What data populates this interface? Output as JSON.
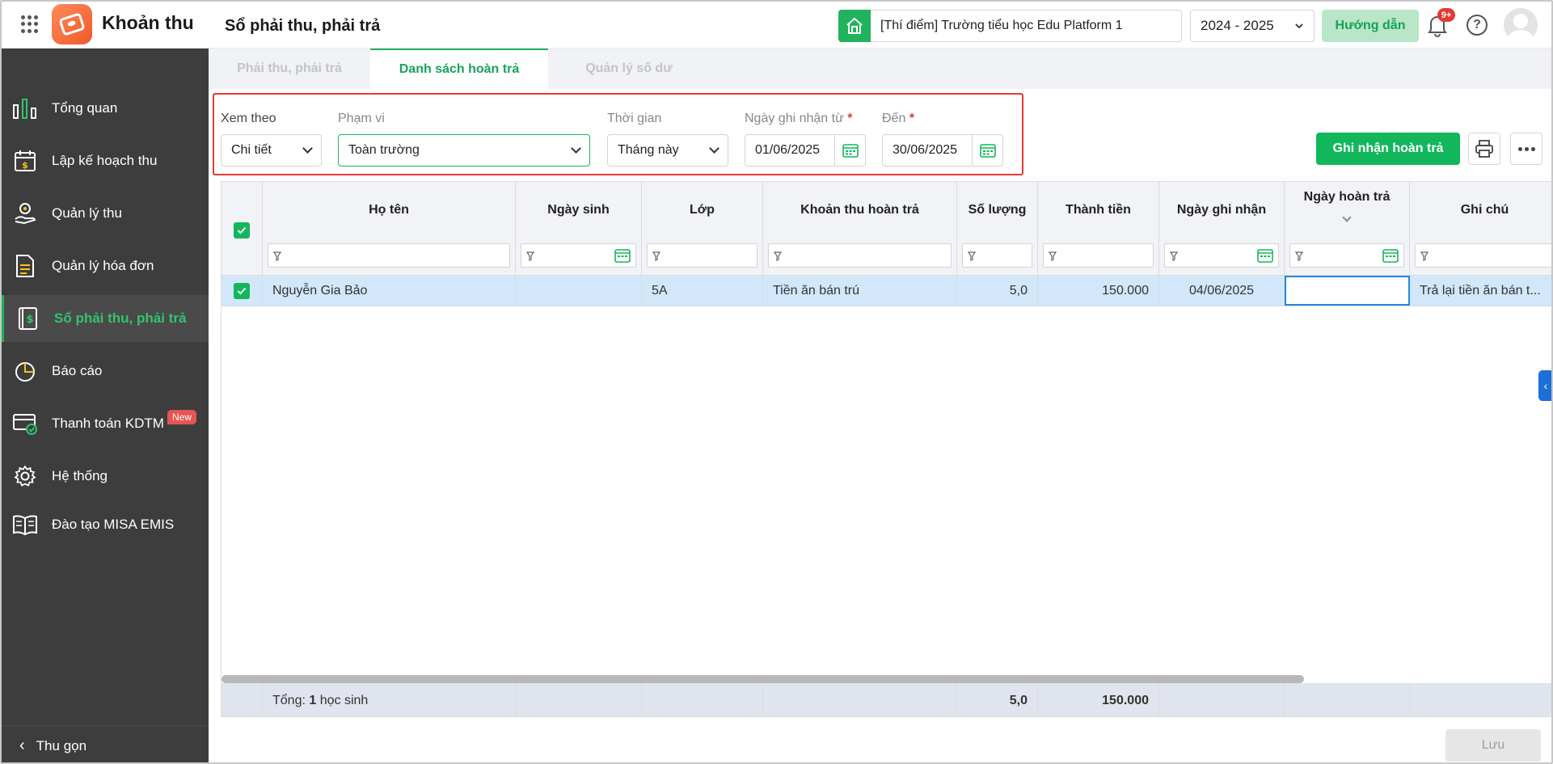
{
  "header": {
    "app_title": "Khoản thu",
    "page_title": "Sổ phải thu, phải trả",
    "school": "[Thí điểm] Trường tiểu học Edu Platform 1",
    "school_year": "2024 - 2025",
    "guide_label": "Hướng dẫn",
    "notification_badge": "9+",
    "help_glyph": "?"
  },
  "sidebar": {
    "items": [
      {
        "label": "Tổng quan",
        "icon": "bar-chart-icon"
      },
      {
        "label": "Lập kế hoạch thu",
        "icon": "calendar-dollar-icon"
      },
      {
        "label": "Quản lý thu",
        "icon": "hand-coin-icon"
      },
      {
        "label": "Quản lý hóa đơn",
        "icon": "invoice-icon"
      },
      {
        "label": "Sổ phải thu, phải trả",
        "icon": "ledger-icon",
        "active": true
      },
      {
        "label": "Báo cáo",
        "icon": "pie-chart-icon"
      },
      {
        "label": "Thanh toán KDTM",
        "icon": "card-payment-icon",
        "badge": "New"
      },
      {
        "label": "Hệ thống",
        "icon": "gear-icon"
      },
      {
        "label": "Đào tạo MISA EMIS",
        "icon": "book-icon"
      }
    ],
    "collapse_label": "Thu gọn"
  },
  "tabs": [
    {
      "label": "Phải thu, phải trả"
    },
    {
      "label": "Danh sách hoàn trả",
      "active": true
    },
    {
      "label": "Quản lý số dư"
    }
  ],
  "filters": {
    "view_label": "Xem theo",
    "view_value": "Chi tiết",
    "scope_label": "Phạm vi",
    "scope_value": "Toàn trường",
    "time_label": "Thời gian",
    "time_value": "Tháng này",
    "from_label": "Ngày ghi nhận từ",
    "from_value": "01/06/2025",
    "to_label": "Đến",
    "to_value": "30/06/2025",
    "required_mark": "*"
  },
  "actions": {
    "record_label": "Ghi nhận hoàn trả",
    "save_label": "Lưu"
  },
  "table": {
    "columns": [
      "Họ tên",
      "Ngày sinh",
      "Lớp",
      "Khoản thu hoàn trả",
      "Số lượng",
      "Thành tiền",
      "Ngày ghi nhận",
      "Ngày hoàn trả",
      "Ghi chú"
    ],
    "rows": [
      {
        "name": "Nguyễn Gia Bảo",
        "dob": "",
        "class": "5A",
        "fee": "Tiền ăn bán trú",
        "quantity": "5,0",
        "amount": "150.000",
        "recorded_date": "04/06/2025",
        "refund_date": "",
        "note": "Trả lại tiền ăn bán t..."
      }
    ],
    "footer": {
      "total_prefix": "Tổng:",
      "total_count": "1",
      "total_suffix": "học sinh",
      "quantity": "5,0",
      "amount": "150.000"
    }
  },
  "colors": {
    "accent": "#12b75c",
    "sidebar_bg": "#3d3d3d",
    "selected_row": "#d2e7fa",
    "highlight_border": "#e53935"
  }
}
